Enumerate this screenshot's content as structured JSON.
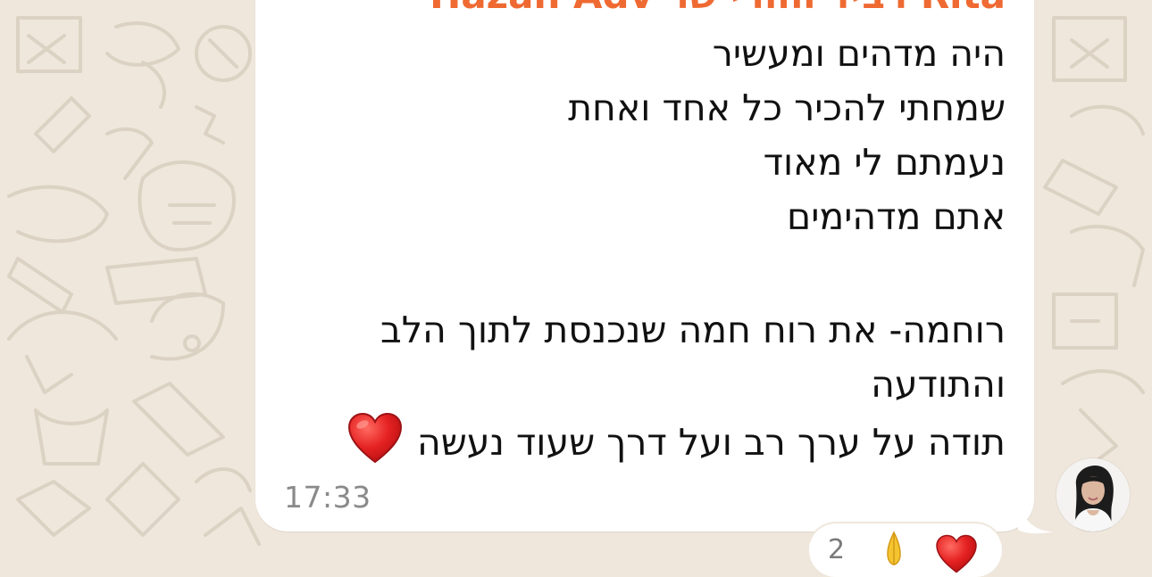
{
  "message": {
    "sender_name": "Rita רביד הוורי שר Hazan Adv",
    "lines": [
      "היה מדהים ומעשיר",
      "שמחתי להכיר כל אחד ואחת",
      "נעמתם לי מאוד",
      "אתם מדהימים",
      "",
      "רוחמה- את רוח חמה שנכנסת לתוך הלב",
      "והתודעה",
      "תודה על ערך רב ועל דרך שעוד נעשה"
    ],
    "time": "17:33",
    "emoji": "heart-emoji"
  },
  "reactions": {
    "count": "2",
    "items": [
      "folded-hands-emoji",
      "heart-emoji"
    ]
  },
  "colors": {
    "wallpaper": "#efe7dc",
    "bubble": "#ffffff",
    "sender_name": "#ef6a32",
    "text": "#111111",
    "time": "#8a8a8a"
  }
}
